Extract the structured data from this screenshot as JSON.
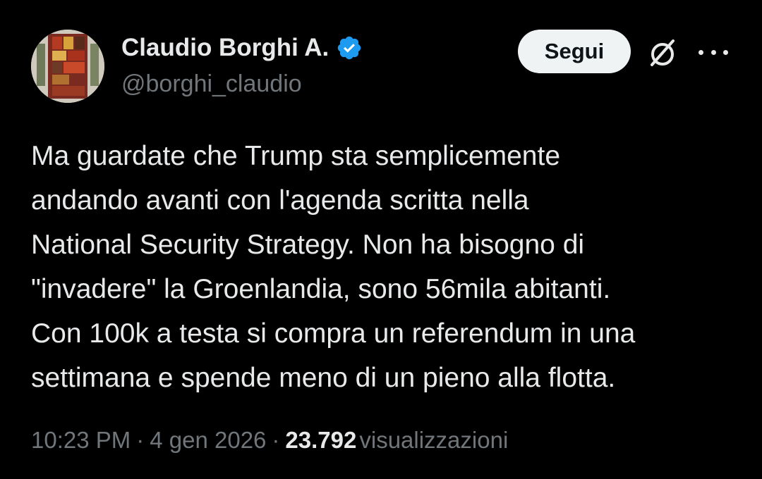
{
  "author": {
    "name": "Claudio Borghi A.",
    "handle": "@borghi_claudio",
    "verified": true
  },
  "actions": {
    "follow_label": "Segui",
    "grok_icon": "grok-icon",
    "more_icon": "more-icon"
  },
  "tweet": {
    "lines": [
      "Ma guardate che Trump sta semplicemente",
      "andando avanti con l'agenda scritta nella",
      "National Security Strategy. Non ha bisogno di",
      "\"invadere\" la Groenlandia, sono 56mila abitanti.",
      "Con 100k a testa si compra un referendum in una",
      "settimana e spende meno di un pieno alla flotta."
    ]
  },
  "meta": {
    "time": "10:23 PM",
    "separator": "·",
    "date": "4 gen 2026",
    "views_count": "23.792",
    "views_label": "visualizzazioni"
  },
  "colors": {
    "background": "#000000",
    "text_primary": "#e7e9ea",
    "text_secondary": "#71767b",
    "verified_blue": "#1d9bf0",
    "follow_bg": "#eff3f4"
  }
}
